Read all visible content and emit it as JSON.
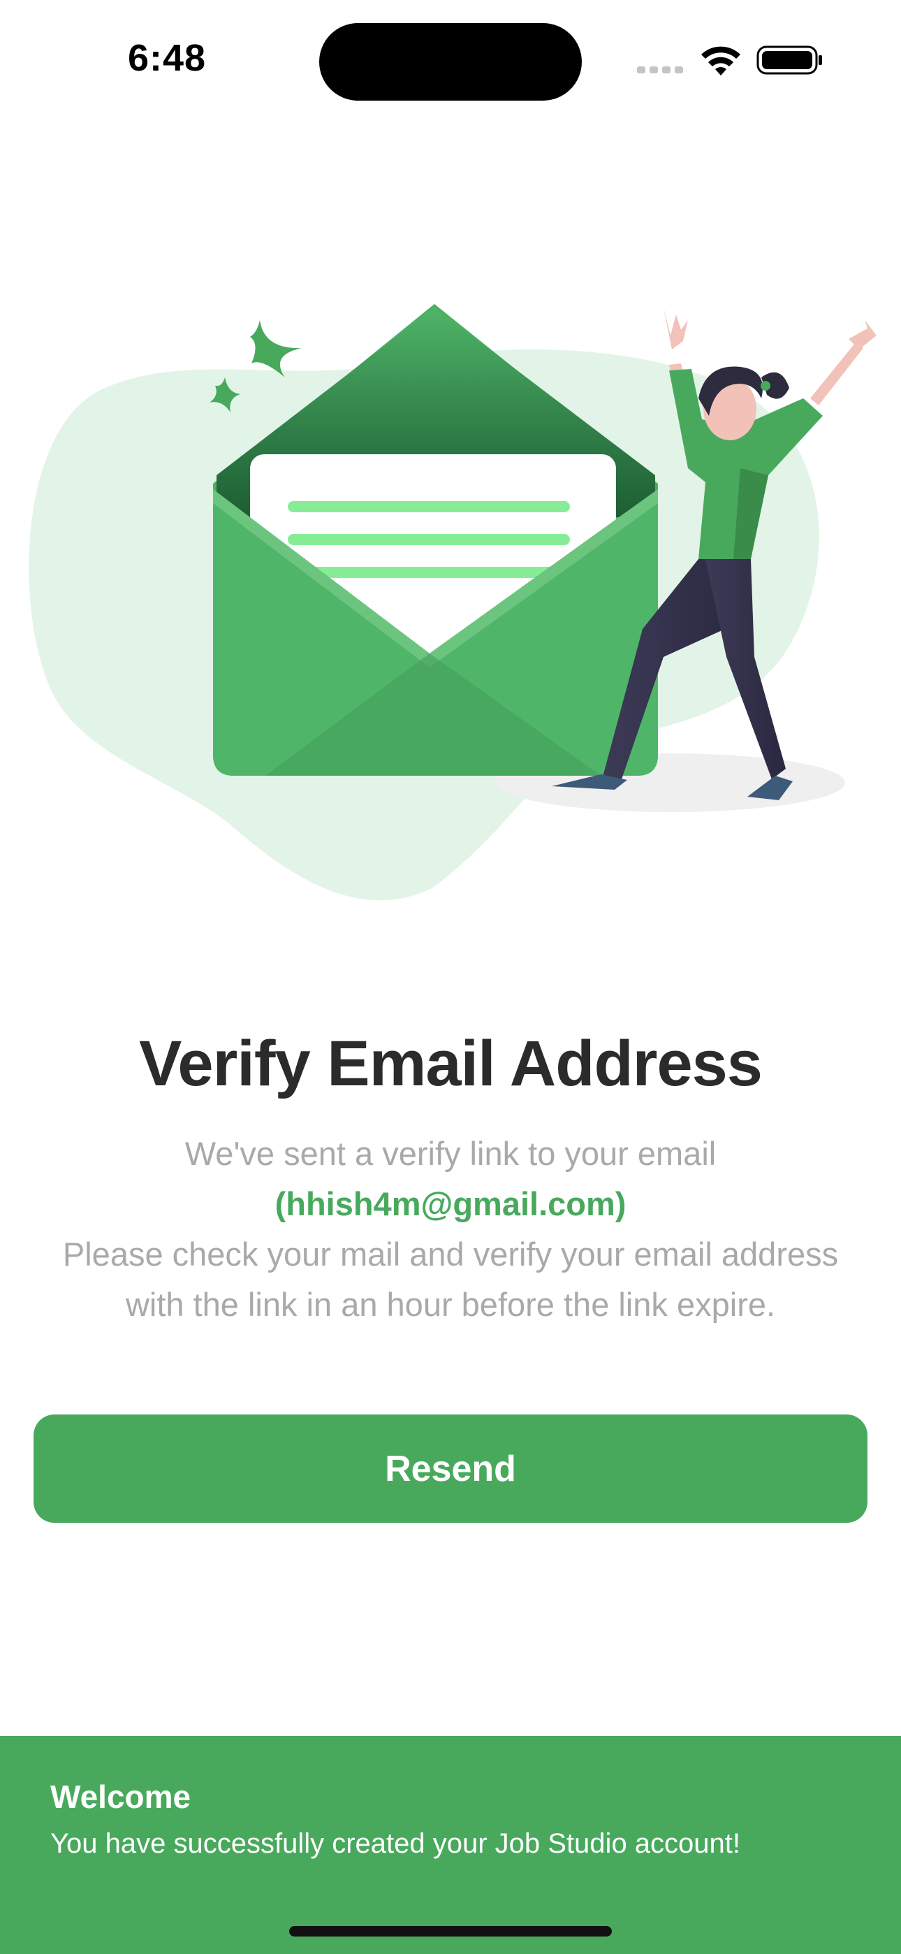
{
  "status_bar": {
    "time": "6:48"
  },
  "icons": {
    "wifi": "wifi-icon",
    "battery": "battery-icon",
    "signal": "cellular-signal-icon"
  },
  "main": {
    "title": "Verify Email Address",
    "description_line1": "We've sent a verify link to your email",
    "email": "(hhish4m@gmail.com)",
    "description_line2": "Please check your mail and verify your email address",
    "description_line3": "with the link in an hour before the link expire.",
    "resend_label": "Resend"
  },
  "toast": {
    "title": "Welcome",
    "message": "You have successfully created your Job Studio account!"
  },
  "colors": {
    "brand_green": "#48a95d",
    "blob_green": "#e2f4e7",
    "title_text": "#2b2b2b",
    "muted_text": "#a9a9a9"
  }
}
